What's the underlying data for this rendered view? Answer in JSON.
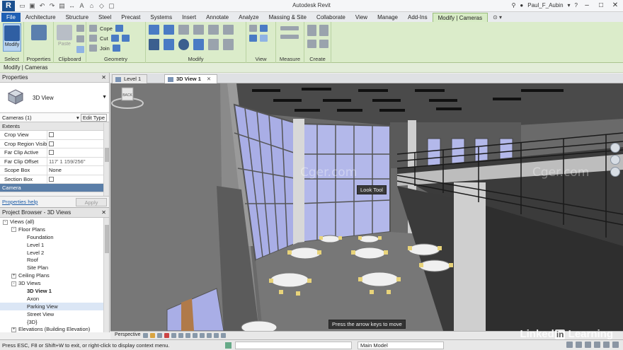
{
  "app": {
    "title": "Autodesk Revit",
    "user": "Paul_F_Aubin"
  },
  "tabs": [
    "File",
    "Architecture",
    "Structure",
    "Steel",
    "Precast",
    "Systems",
    "Insert",
    "Annotate",
    "Analyze",
    "Massing & Site",
    "Collaborate",
    "View",
    "Manage",
    "Add-Ins",
    "Modify | Cameras"
  ],
  "ribbon": {
    "select_button": "Modify",
    "select_label": "Select",
    "properties_button": "Properties",
    "paste_button": "Paste",
    "clipboard_label": "Clipboard",
    "cope": "Cope",
    "cut": "Cut",
    "join": "Join",
    "geometry_label": "Geometry",
    "modify_label": "Modify",
    "view_label": "View",
    "measure_label": "Measure",
    "create_label": "Create"
  },
  "context_bar": "Modify | Cameras",
  "properties": {
    "title": "Properties",
    "type_name": "3D View",
    "instance": "Cameras (1)",
    "edit_type": "Edit Type",
    "section_extents": "Extents",
    "rows": [
      {
        "name": "Crop View",
        "value": ""
      },
      {
        "name": "Crop Region Visible",
        "value": ""
      },
      {
        "name": "Far Clip Active",
        "value": ""
      },
      {
        "name": "Far Clip Offset",
        "value": "117'  1 159/256\""
      },
      {
        "name": "Scope Box",
        "value": "None"
      },
      {
        "name": "Section Box",
        "value": ""
      }
    ],
    "section_camera": "Camera",
    "help": "Properties help",
    "apply": "Apply"
  },
  "browser": {
    "title": "Project Browser - 3D Views",
    "nodes": [
      {
        "label": "Views (all)",
        "level": 0,
        "toggle": "-"
      },
      {
        "label": "Floor Plans",
        "level": 1,
        "toggle": "-"
      },
      {
        "label": "Foundation",
        "level": 2,
        "toggle": ""
      },
      {
        "label": "Level 1",
        "level": 2,
        "toggle": ""
      },
      {
        "label": "Level 2",
        "level": 2,
        "toggle": ""
      },
      {
        "label": "Roof",
        "level": 2,
        "toggle": ""
      },
      {
        "label": "Site Plan",
        "level": 2,
        "toggle": ""
      },
      {
        "label": "Ceiling Plans",
        "level": 1,
        "toggle": "+"
      },
      {
        "label": "3D Views",
        "level": 1,
        "toggle": "-"
      },
      {
        "label": "3D View 1",
        "level": 2,
        "toggle": "",
        "bold": true
      },
      {
        "label": "Axon",
        "level": 2,
        "toggle": ""
      },
      {
        "label": "Parking View",
        "level": 2,
        "toggle": "",
        "selected": true
      },
      {
        "label": "Street View",
        "level": 2,
        "toggle": ""
      },
      {
        "label": "{3D}",
        "level": 2,
        "toggle": ""
      },
      {
        "label": "Elevations (Building Elevation)",
        "level": 1,
        "toggle": "+"
      }
    ]
  },
  "view_tabs": [
    {
      "label": "Level 1"
    },
    {
      "label": "3D View 1",
      "active": true
    }
  ],
  "viewport": {
    "look_tool_tip": "Look Tool",
    "arrow_tip": "Press the arrow keys to move",
    "viewcube_label": "BACK",
    "watermark": "Cger.com"
  },
  "view_control": {
    "projection": "Perspective"
  },
  "status": {
    "message": "Press ESC, F8 or Shift+W to exit, or right-click to display context menu.",
    "model": "Main Model",
    "brand": "Linked",
    "brand_suffix": "in",
    "brand_tail": " Learning"
  },
  "colors": {
    "ribbon_bg": "#dbecca",
    "file_tab": "#1f5fb4",
    "window_glass": "#aab0e0"
  }
}
